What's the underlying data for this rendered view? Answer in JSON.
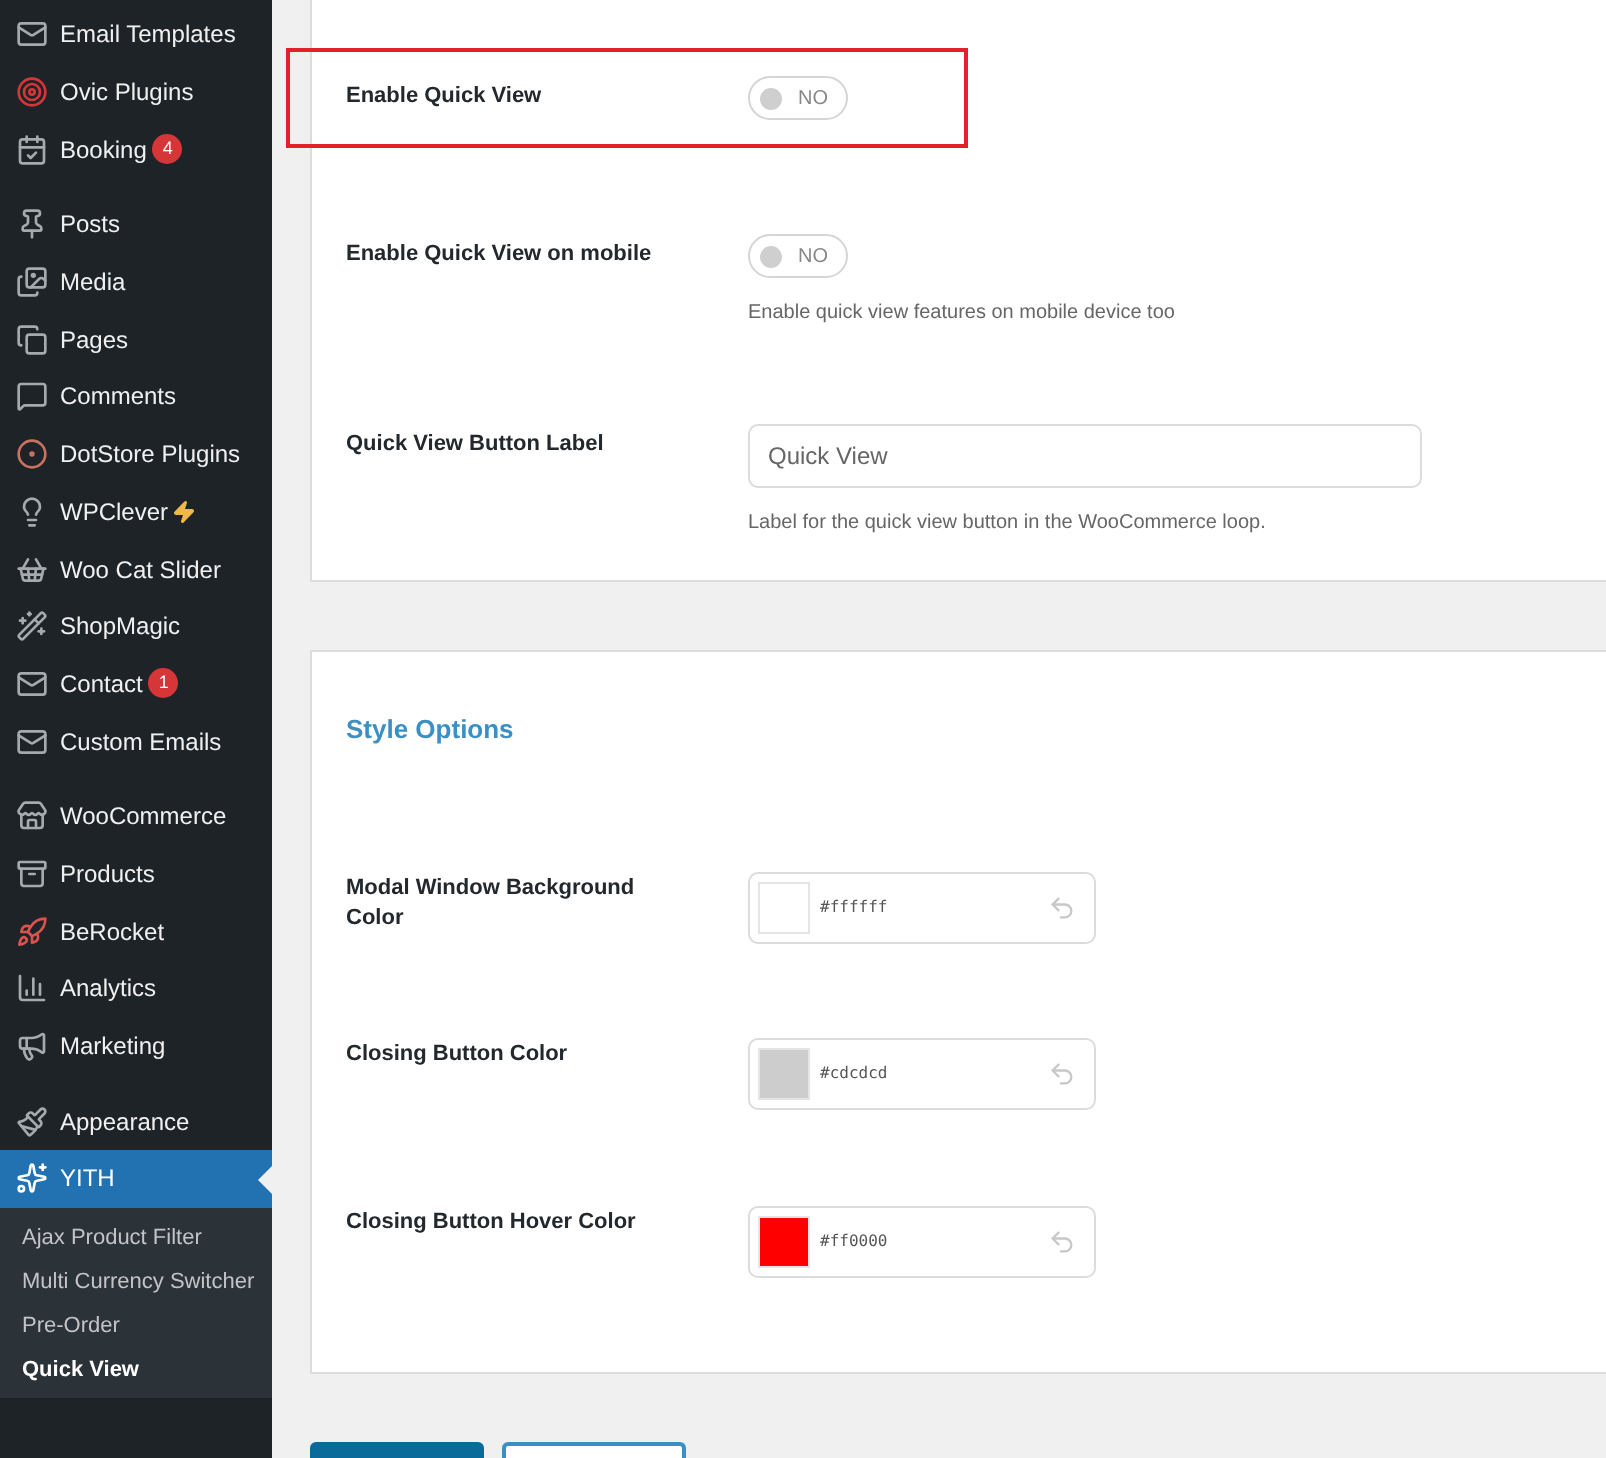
{
  "sidebar": {
    "groups": [
      {
        "items": [
          {
            "label": "Email Templates"
          },
          {
            "label": "Ovic Plugins"
          },
          {
            "label": "Booking",
            "badge": "4"
          }
        ]
      },
      {
        "items": [
          {
            "label": "Posts"
          },
          {
            "label": "Media"
          },
          {
            "label": "Pages"
          },
          {
            "label": "Comments"
          },
          {
            "label": "DotStore Plugins"
          },
          {
            "label": "WPClever"
          },
          {
            "label": "Woo Cat Slider"
          },
          {
            "label": "ShopMagic"
          },
          {
            "label": "Contact",
            "badge": "1"
          },
          {
            "label": "Custom Emails"
          }
        ]
      },
      {
        "items": [
          {
            "label": "WooCommerce"
          },
          {
            "label": "Products"
          },
          {
            "label": "BeRocket"
          },
          {
            "label": "Analytics"
          },
          {
            "label": "Marketing"
          }
        ]
      },
      {
        "items": [
          {
            "label": "Appearance"
          },
          {
            "label": "YITH",
            "selected": true
          }
        ]
      }
    ],
    "submenu": [
      {
        "label": "Ajax Product Filter",
        "selected": false
      },
      {
        "label": "Multi Currency Switcher",
        "selected": false
      },
      {
        "label": "Pre-Order",
        "selected": false
      },
      {
        "label": "Quick View",
        "selected": true
      }
    ]
  },
  "general_panel": {
    "rows": [
      {
        "kind": "toggle",
        "label": "Enable Quick View",
        "on": false,
        "state_text": "NO",
        "highlighted": true
      },
      {
        "kind": "toggle",
        "label": "Enable Quick View on mobile",
        "on": false,
        "state_text": "NO",
        "description": "Enable quick view features on mobile device too",
        "highlighted": false
      },
      {
        "kind": "text",
        "label": "Quick View Button Label",
        "value": "Quick View",
        "description": "Label for the quick view button in the WooCommerce loop.",
        "highlighted": false
      }
    ]
  },
  "style_panel": {
    "title": "Style Options",
    "rows": [
      {
        "label": "Modal Window Background Color",
        "value": "#ffffff",
        "color": "#ffffff"
      },
      {
        "label": "Closing Button Color",
        "value": "#cdcdcd",
        "color": "#cdcdcd"
      },
      {
        "label": "Closing Button Hover Color",
        "value": "#ff0000",
        "color": "#ff0000"
      }
    ]
  }
}
